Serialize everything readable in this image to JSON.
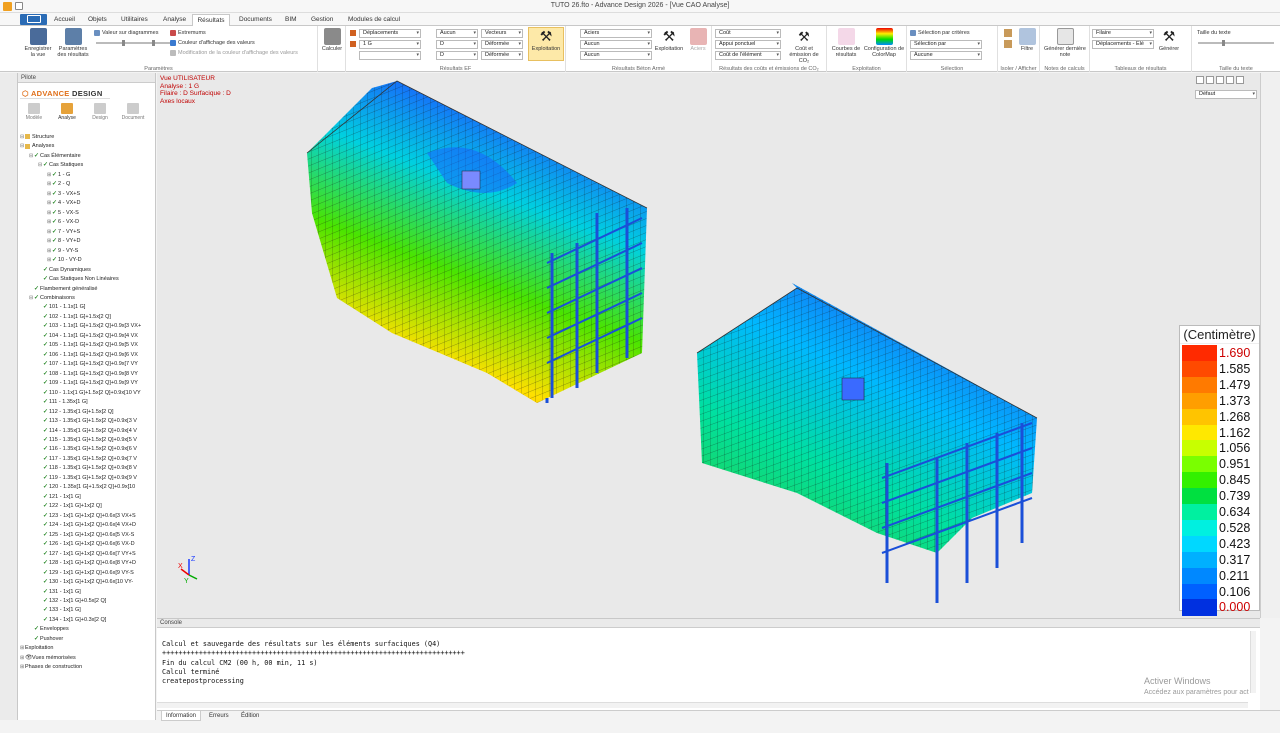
{
  "window": {
    "title": "TUTO 26.fto - Advance Design 2026 - [Vue CAO Analyse]"
  },
  "tabs": [
    {
      "label": "Accueil"
    },
    {
      "label": "Objets"
    },
    {
      "label": "Utilitaires"
    },
    {
      "label": "Analyse"
    },
    {
      "label": "Résultats",
      "active": true
    },
    {
      "label": "Documents"
    },
    {
      "label": "BIM"
    },
    {
      "label": "Gestion"
    },
    {
      "label": "Modules de calcul"
    }
  ],
  "ribbon": {
    "parametres": {
      "label": "Paramètres",
      "save_view": "Enregistrer la vue",
      "result_params": "Paramètres des résultats",
      "diagram_value": "Valeur sur diagrammes",
      "extremums": "Extremums",
      "value_color": "Couleur d'affichage des valeurs",
      "modify_color": "Modification de la couleur d'affichage des valeurs"
    },
    "calculer": "Calculer",
    "resultats_ef": {
      "label": "Résultats EF",
      "c1": "Déplacements",
      "c2": "1 G",
      "c3": "",
      "c4": "Aucun",
      "c5": "D",
      "c6": "D",
      "c7": "Vecteurs",
      "c8": "Déformée",
      "c9": "Déformée",
      "exploitation": "Exploitation"
    },
    "beton": {
      "label": "Résultats Béton Armé",
      "c1": "Aciers",
      "c2": "Aucun",
      "c3": "Aucun",
      "exploitation": "Exploitation",
      "aciers": "Aciers"
    },
    "couts": {
      "label": "Résultats des coûts et émissions de CO₂",
      "c1": "Coût",
      "c2": "Appui ponctuel",
      "c3": "Coût de l'élément",
      "btn": "Coût et émission de CO₂"
    },
    "exploitation": {
      "label": "Exploitation",
      "courbes": "Courbes de résultats",
      "colormap": "Configuration de ColorMap"
    },
    "selection": {
      "label": "Sélection",
      "criteres": "Sélection par critères",
      "par": "Sélection par",
      "c1": "Aucune"
    },
    "isoler": {
      "label": "Isoler / Afficher",
      "filtre": "Filtre"
    },
    "notes": {
      "label": "Notes de calculs",
      "generer": "Générer dernière note"
    },
    "tableaux": {
      "label": "Tableaux de résultats",
      "c1": "Filaire",
      "c2": "Déplacements - Élé",
      "generer": "Générer"
    },
    "texte": {
      "label": "Taille du texte",
      "taille": "Taille du texte"
    }
  },
  "pilote": {
    "title": "Pilote",
    "logo_pre": "⬡ ADVANCE",
    "logo_post": " DESIGN",
    "modes": [
      "Modèle",
      "Analyse",
      "Design",
      "Document"
    ],
    "tree": [
      {
        "l": 0,
        "ex": "⊟",
        "ic": "fi",
        "t": "Structure"
      },
      {
        "l": 0,
        "ex": "⊟",
        "ic": "fi",
        "t": "Analyses"
      },
      {
        "l": 1,
        "ex": "⊟",
        "ic": "ck",
        "t": "Cas Élémentaire"
      },
      {
        "l": 2,
        "ex": "⊟",
        "ic": "ck",
        "t": "Cas Statiques"
      },
      {
        "l": 3,
        "ex": "⊞",
        "ic": "ck",
        "t": "1 - G"
      },
      {
        "l": 3,
        "ex": "⊞",
        "ic": "ck",
        "t": "2 - Q"
      },
      {
        "l": 3,
        "ex": "⊞",
        "ic": "ck",
        "t": "3 - VX+S"
      },
      {
        "l": 3,
        "ex": "⊞",
        "ic": "ck",
        "t": "4 - VX+D"
      },
      {
        "l": 3,
        "ex": "⊞",
        "ic": "ck",
        "t": "5 - VX-S"
      },
      {
        "l": 3,
        "ex": "⊞",
        "ic": "ck",
        "t": "6 - VX-D"
      },
      {
        "l": 3,
        "ex": "⊞",
        "ic": "ck",
        "t": "7 - VY+S"
      },
      {
        "l": 3,
        "ex": "⊞",
        "ic": "ck",
        "t": "8 - VY+D"
      },
      {
        "l": 3,
        "ex": "⊞",
        "ic": "ck",
        "t": "9 - VY-S"
      },
      {
        "l": 3,
        "ex": "⊞",
        "ic": "ck",
        "t": "10 - VY-D"
      },
      {
        "l": 2,
        "ex": "",
        "ic": "ck",
        "t": "Cas Dynamiques"
      },
      {
        "l": 2,
        "ex": "",
        "ic": "ck",
        "t": "Cas Statiques Non Linéaires"
      },
      {
        "l": 1,
        "ex": "",
        "ic": "ck",
        "t": "Flambement généralisé"
      },
      {
        "l": 1,
        "ex": "⊟",
        "ic": "ck",
        "t": "Combinaisons"
      },
      {
        "l": 2,
        "ex": "",
        "ic": "ck",
        "t": "101 - 1.1x[1 G]"
      },
      {
        "l": 2,
        "ex": "",
        "ic": "ck",
        "t": "102 - 1.1x[1 G]+1.5x[2 Q]"
      },
      {
        "l": 2,
        "ex": "",
        "ic": "ck",
        "t": "103 - 1.1x[1 G]+1.5x[2 Q]+0.9x[3 VX+"
      },
      {
        "l": 2,
        "ex": "",
        "ic": "ck",
        "t": "104 - 1.1x[1 G]+1.5x[2 Q]+0.9x[4 VX"
      },
      {
        "l": 2,
        "ex": "",
        "ic": "ck",
        "t": "105 - 1.1x[1 G]+1.5x[2 Q]+0.9x[5 VX"
      },
      {
        "l": 2,
        "ex": "",
        "ic": "ck",
        "t": "106 - 1.1x[1 G]+1.5x[2 Q]+0.9x[6 VX"
      },
      {
        "l": 2,
        "ex": "",
        "ic": "ck",
        "t": "107 - 1.1x[1 G]+1.5x[2 Q]+0.9x[7 VY"
      },
      {
        "l": 2,
        "ex": "",
        "ic": "ck",
        "t": "108 - 1.1x[1 G]+1.5x[2 Q]+0.9x[8 VY"
      },
      {
        "l": 2,
        "ex": "",
        "ic": "ck",
        "t": "109 - 1.1x[1 G]+1.5x[2 Q]+0.9x[9 VY"
      },
      {
        "l": 2,
        "ex": "",
        "ic": "ck",
        "t": "110 - 1.1x[1 G]+1.5x[2 Q]+0.9x[10 VY"
      },
      {
        "l": 2,
        "ex": "",
        "ic": "ck",
        "t": "111 - 1.35x[1 G]"
      },
      {
        "l": 2,
        "ex": "",
        "ic": "ck",
        "t": "112 - 1.35x[1 G]+1.5x[2 Q]"
      },
      {
        "l": 2,
        "ex": "",
        "ic": "ck",
        "t": "113 - 1.35x[1 G]+1.5x[2 Q]+0.9x[3 V"
      },
      {
        "l": 2,
        "ex": "",
        "ic": "ck",
        "t": "114 - 1.35x[1 G]+1.5x[2 Q]+0.9x[4 V"
      },
      {
        "l": 2,
        "ex": "",
        "ic": "ck",
        "t": "115 - 1.35x[1 G]+1.5x[2 Q]+0.9x[5 V"
      },
      {
        "l": 2,
        "ex": "",
        "ic": "ck",
        "t": "116 - 1.35x[1 G]+1.5x[2 Q]+0.9x[6 V"
      },
      {
        "l": 2,
        "ex": "",
        "ic": "ck",
        "t": "117 - 1.35x[1 G]+1.5x[2 Q]+0.9x[7 V"
      },
      {
        "l": 2,
        "ex": "",
        "ic": "ck",
        "t": "118 - 1.35x[1 G]+1.5x[2 Q]+0.9x[8 V"
      },
      {
        "l": 2,
        "ex": "",
        "ic": "ck",
        "t": "119 - 1.35x[1 G]+1.5x[2 Q]+0.9x[9 V"
      },
      {
        "l": 2,
        "ex": "",
        "ic": "ck",
        "t": "120 - 1.35x[1 G]+1.5x[2 Q]+0.9x[10"
      },
      {
        "l": 2,
        "ex": "",
        "ic": "ck",
        "t": "121 - 1x[1 G]"
      },
      {
        "l": 2,
        "ex": "",
        "ic": "ck",
        "t": "122 - 1x[1 G]+1x[2 Q]"
      },
      {
        "l": 2,
        "ex": "",
        "ic": "ck",
        "t": "123 - 1x[1 G]+1x[2 Q]+0.6x[3 VX+S"
      },
      {
        "l": 2,
        "ex": "",
        "ic": "ck",
        "t": "124 - 1x[1 G]+1x[2 Q]+0.6x[4 VX+D"
      },
      {
        "l": 2,
        "ex": "",
        "ic": "ck",
        "t": "125 - 1x[1 G]+1x[2 Q]+0.6x[5 VX-S"
      },
      {
        "l": 2,
        "ex": "",
        "ic": "ck",
        "t": "126 - 1x[1 G]+1x[2 Q]+0.6x[6 VX-D"
      },
      {
        "l": 2,
        "ex": "",
        "ic": "ck",
        "t": "127 - 1x[1 G]+1x[2 Q]+0.6x[7 VY+S"
      },
      {
        "l": 2,
        "ex": "",
        "ic": "ck",
        "t": "128 - 1x[1 G]+1x[2 Q]+0.6x[8 VY+D"
      },
      {
        "l": 2,
        "ex": "",
        "ic": "ck",
        "t": "129 - 1x[1 G]+1x[2 Q]+0.6x[9 VY-S"
      },
      {
        "l": 2,
        "ex": "",
        "ic": "ck",
        "t": "130 - 1x[1 G]+1x[2 Q]+0.6x[10 VY-"
      },
      {
        "l": 2,
        "ex": "",
        "ic": "ck",
        "t": "131 - 1x[1 G]"
      },
      {
        "l": 2,
        "ex": "",
        "ic": "ck",
        "t": "132 - 1x[1 G]+0.5x[2 Q]"
      },
      {
        "l": 2,
        "ex": "",
        "ic": "ck",
        "t": "133 - 1x[1 G]"
      },
      {
        "l": 2,
        "ex": "",
        "ic": "ck",
        "t": "134 - 1x[1 G]+0.3x[2 Q]"
      },
      {
        "l": 1,
        "ex": "",
        "ic": "ck",
        "t": "Enveloppes"
      },
      {
        "l": 1,
        "ex": "",
        "ic": "ck",
        "t": "Pushover"
      },
      {
        "l": 0,
        "ex": "⊞",
        "ic": "",
        "t": "Exploitation"
      },
      {
        "l": 0,
        "ex": "⊞",
        "ic": "eye",
        "t": "Vues mémorisées"
      },
      {
        "l": 0,
        "ex": "⊞",
        "ic": "",
        "t": "Phases de construction"
      }
    ]
  },
  "view": {
    "info": [
      "Vue UTILISATEUR",
      "Analyse : 1 G",
      "Filaire : D Surfacique : D",
      "Axes locaux"
    ],
    "preset": "Défaut",
    "axes": {
      "x": "X",
      "y": "Y",
      "z": "Z"
    }
  },
  "legend": {
    "unit": "(Centimètre)",
    "values": [
      "1.690",
      "1.585",
      "1.479",
      "1.373",
      "1.268",
      "1.162",
      "1.056",
      "0.951",
      "0.845",
      "0.739",
      "0.634",
      "0.528",
      "0.423",
      "0.317",
      "0.211",
      "0.106",
      "0.000"
    ],
    "colors": [
      "#ff2a00",
      "#ff4a00",
      "#ff7a00",
      "#ff9e00",
      "#ffc400",
      "#ffe800",
      "#c8ff00",
      "#7aff00",
      "#33f000",
      "#00e040",
      "#00f0a0",
      "#00f0e0",
      "#00d8ff",
      "#00b0ff",
      "#0088ff",
      "#0060ff",
      "#0030e0"
    ],
    "value_colors": {
      "max": "#cc0000",
      "min": "#cc0000"
    }
  },
  "console": {
    "title": "Console",
    "lines": [
      "Calcul et sauvegarde des résultats sur les éléments surfaciques (Q4)",
      "++++++++++++++++++++++++++++++++++++++++++++++++++++++++++++++++++++++++++",
      "Fin du calcul CM2 (00 h, 00 min, 11 s)",
      "Calcul terminé",
      "createpostprocessing"
    ],
    "tabs": [
      "Information",
      "Erreurs",
      "Édition"
    ]
  },
  "watermark": {
    "line1": "Activer Windows",
    "line2": "Accédez aux paramètres pour act"
  }
}
